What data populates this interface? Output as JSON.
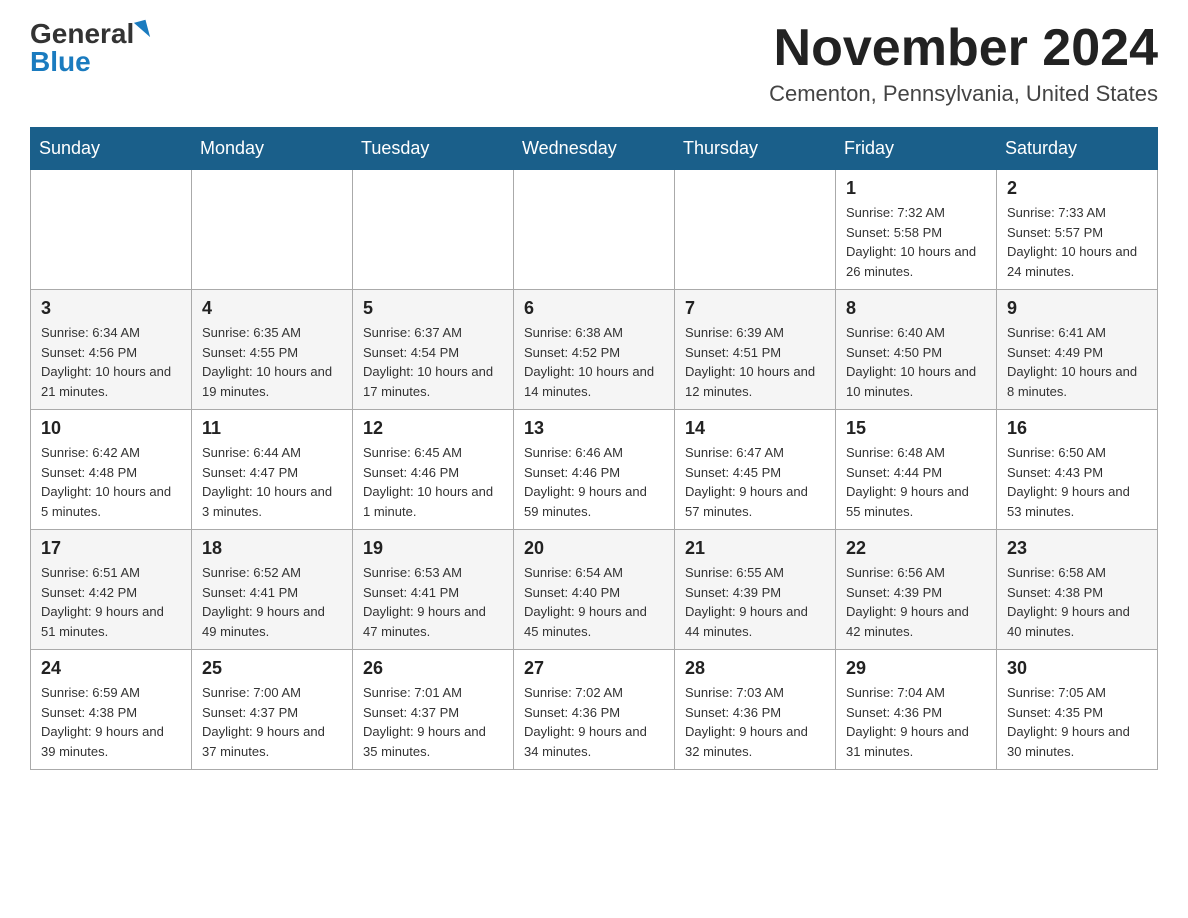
{
  "logo": {
    "general": "General",
    "blue": "Blue"
  },
  "title": "November 2024",
  "location": "Cementon, Pennsylvania, United States",
  "days_of_week": [
    "Sunday",
    "Monday",
    "Tuesday",
    "Wednesday",
    "Thursday",
    "Friday",
    "Saturday"
  ],
  "weeks": [
    [
      {
        "day": "",
        "info": ""
      },
      {
        "day": "",
        "info": ""
      },
      {
        "day": "",
        "info": ""
      },
      {
        "day": "",
        "info": ""
      },
      {
        "day": "",
        "info": ""
      },
      {
        "day": "1",
        "info": "Sunrise: 7:32 AM\nSunset: 5:58 PM\nDaylight: 10 hours and 26 minutes."
      },
      {
        "day": "2",
        "info": "Sunrise: 7:33 AM\nSunset: 5:57 PM\nDaylight: 10 hours and 24 minutes."
      }
    ],
    [
      {
        "day": "3",
        "info": "Sunrise: 6:34 AM\nSunset: 4:56 PM\nDaylight: 10 hours and 21 minutes."
      },
      {
        "day": "4",
        "info": "Sunrise: 6:35 AM\nSunset: 4:55 PM\nDaylight: 10 hours and 19 minutes."
      },
      {
        "day": "5",
        "info": "Sunrise: 6:37 AM\nSunset: 4:54 PM\nDaylight: 10 hours and 17 minutes."
      },
      {
        "day": "6",
        "info": "Sunrise: 6:38 AM\nSunset: 4:52 PM\nDaylight: 10 hours and 14 minutes."
      },
      {
        "day": "7",
        "info": "Sunrise: 6:39 AM\nSunset: 4:51 PM\nDaylight: 10 hours and 12 minutes."
      },
      {
        "day": "8",
        "info": "Sunrise: 6:40 AM\nSunset: 4:50 PM\nDaylight: 10 hours and 10 minutes."
      },
      {
        "day": "9",
        "info": "Sunrise: 6:41 AM\nSunset: 4:49 PM\nDaylight: 10 hours and 8 minutes."
      }
    ],
    [
      {
        "day": "10",
        "info": "Sunrise: 6:42 AM\nSunset: 4:48 PM\nDaylight: 10 hours and 5 minutes."
      },
      {
        "day": "11",
        "info": "Sunrise: 6:44 AM\nSunset: 4:47 PM\nDaylight: 10 hours and 3 minutes."
      },
      {
        "day": "12",
        "info": "Sunrise: 6:45 AM\nSunset: 4:46 PM\nDaylight: 10 hours and 1 minute."
      },
      {
        "day": "13",
        "info": "Sunrise: 6:46 AM\nSunset: 4:46 PM\nDaylight: 9 hours and 59 minutes."
      },
      {
        "day": "14",
        "info": "Sunrise: 6:47 AM\nSunset: 4:45 PM\nDaylight: 9 hours and 57 minutes."
      },
      {
        "day": "15",
        "info": "Sunrise: 6:48 AM\nSunset: 4:44 PM\nDaylight: 9 hours and 55 minutes."
      },
      {
        "day": "16",
        "info": "Sunrise: 6:50 AM\nSunset: 4:43 PM\nDaylight: 9 hours and 53 minutes."
      }
    ],
    [
      {
        "day": "17",
        "info": "Sunrise: 6:51 AM\nSunset: 4:42 PM\nDaylight: 9 hours and 51 minutes."
      },
      {
        "day": "18",
        "info": "Sunrise: 6:52 AM\nSunset: 4:41 PM\nDaylight: 9 hours and 49 minutes."
      },
      {
        "day": "19",
        "info": "Sunrise: 6:53 AM\nSunset: 4:41 PM\nDaylight: 9 hours and 47 minutes."
      },
      {
        "day": "20",
        "info": "Sunrise: 6:54 AM\nSunset: 4:40 PM\nDaylight: 9 hours and 45 minutes."
      },
      {
        "day": "21",
        "info": "Sunrise: 6:55 AM\nSunset: 4:39 PM\nDaylight: 9 hours and 44 minutes."
      },
      {
        "day": "22",
        "info": "Sunrise: 6:56 AM\nSunset: 4:39 PM\nDaylight: 9 hours and 42 minutes."
      },
      {
        "day": "23",
        "info": "Sunrise: 6:58 AM\nSunset: 4:38 PM\nDaylight: 9 hours and 40 minutes."
      }
    ],
    [
      {
        "day": "24",
        "info": "Sunrise: 6:59 AM\nSunset: 4:38 PM\nDaylight: 9 hours and 39 minutes."
      },
      {
        "day": "25",
        "info": "Sunrise: 7:00 AM\nSunset: 4:37 PM\nDaylight: 9 hours and 37 minutes."
      },
      {
        "day": "26",
        "info": "Sunrise: 7:01 AM\nSunset: 4:37 PM\nDaylight: 9 hours and 35 minutes."
      },
      {
        "day": "27",
        "info": "Sunrise: 7:02 AM\nSunset: 4:36 PM\nDaylight: 9 hours and 34 minutes."
      },
      {
        "day": "28",
        "info": "Sunrise: 7:03 AM\nSunset: 4:36 PM\nDaylight: 9 hours and 32 minutes."
      },
      {
        "day": "29",
        "info": "Sunrise: 7:04 AM\nSunset: 4:36 PM\nDaylight: 9 hours and 31 minutes."
      },
      {
        "day": "30",
        "info": "Sunrise: 7:05 AM\nSunset: 4:35 PM\nDaylight: 9 hours and 30 minutes."
      }
    ]
  ]
}
